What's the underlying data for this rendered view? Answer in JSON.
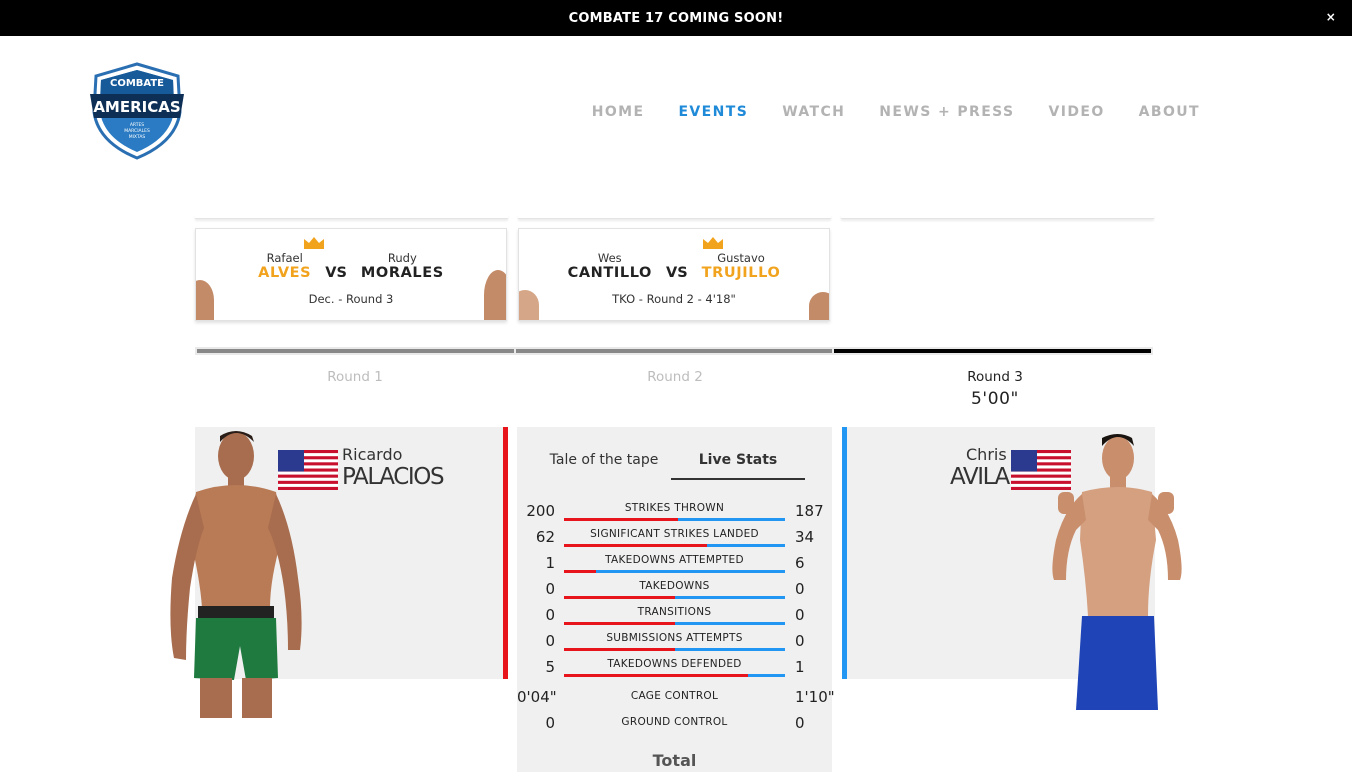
{
  "banner": {
    "text": "COMBATE 17 COMING SOON!",
    "close": "×"
  },
  "logo": {
    "line1": "COMBATE",
    "line2": "AMERICAS",
    "line3": "ARTES",
    "line4": "MARCIALES",
    "line5": "MIXTAS"
  },
  "nav": [
    {
      "label": "HOME",
      "active": false
    },
    {
      "label": "EVENTS",
      "active": true
    },
    {
      "label": "WATCH",
      "active": false
    },
    {
      "label": "NEWS + PRESS",
      "active": false
    },
    {
      "label": "VIDEO",
      "active": false
    },
    {
      "label": "ABOUT",
      "active": false
    }
  ],
  "fight_cards": [
    {
      "left_first": "Rafael",
      "left_last": "ALVES",
      "left_winner": true,
      "vs": "VS",
      "right_first": "Rudy",
      "right_last": "MORALES",
      "right_winner": false,
      "result": "Dec. - Round 3"
    },
    {
      "left_first": "Wes",
      "left_last": "CANTILLO",
      "left_winner": false,
      "vs": "VS",
      "right_first": "Gustavo",
      "right_last": "TRUJILLO",
      "right_winner": true,
      "result": "TKO - Round 2 - 4'18\""
    }
  ],
  "rounds": [
    {
      "label": "Round 1",
      "active": false
    },
    {
      "label": "Round 2",
      "active": false
    },
    {
      "label": "Round 3",
      "active": true,
      "time": "5'00\""
    }
  ],
  "fighter_left": {
    "first": "Ricardo",
    "last": "PALACIOS",
    "corner_color": "#e8141b",
    "flag": "us-flag"
  },
  "fighter_right": {
    "first": "Chris",
    "last": "AVILA",
    "corner_color": "#2196f3",
    "flag": "us-flag"
  },
  "tabs": [
    {
      "label": "Tale of the tape",
      "active": false
    },
    {
      "label": "Live Stats",
      "active": true
    }
  ],
  "stats": [
    {
      "label": "STRIKES THROWN",
      "left": "200",
      "right": "187",
      "bar": true,
      "red_fraction": 0.517
    },
    {
      "label": "SIGNIFICANT STRIKES LANDED",
      "left": "62",
      "right": "34",
      "bar": true,
      "red_fraction": 0.646
    },
    {
      "label": "TAKEDOWNS ATTEMPTED",
      "left": "1",
      "right": "6",
      "bar": true,
      "red_fraction": 0.143
    },
    {
      "label": "TAKEDOWNS",
      "left": "0",
      "right": "0",
      "bar": true,
      "red_fraction": 0.5
    },
    {
      "label": "TRANSITIONS",
      "left": "0",
      "right": "0",
      "bar": true,
      "red_fraction": 0.5
    },
    {
      "label": "SUBMISSIONS ATTEMPTS",
      "left": "0",
      "right": "0",
      "bar": true,
      "red_fraction": 0.5
    },
    {
      "label": "TAKEDOWNS DEFENDED",
      "left": "5",
      "right": "1",
      "bar": true,
      "red_fraction": 0.833
    },
    {
      "label": "CAGE CONTROL",
      "left": "0'04\"",
      "right": "1'10\"",
      "bar": false
    },
    {
      "label": "GROUND CONTROL",
      "left": "0",
      "right": "0",
      "bar": false
    }
  ],
  "total_label": "Total",
  "colors": {
    "accent_blue": "#1f8ad8",
    "winner_gold": "#f2a31d",
    "red_corner": "#e8141b",
    "blue_corner": "#2196f3"
  }
}
